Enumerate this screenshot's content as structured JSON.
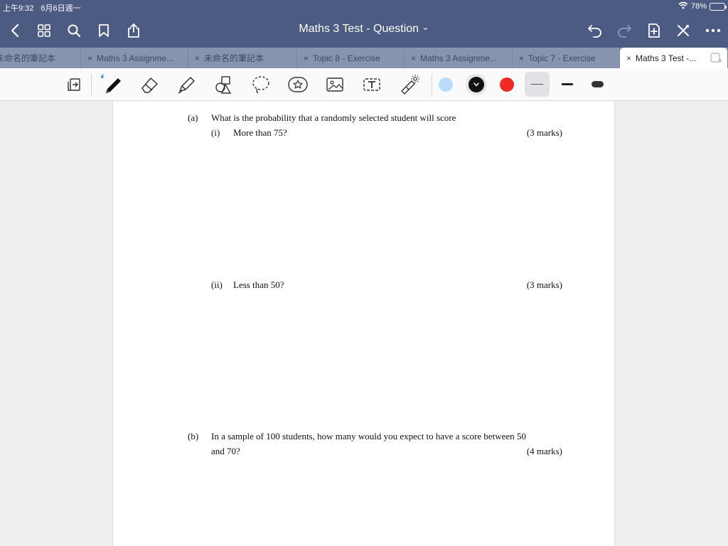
{
  "status": {
    "time": "上午9:32",
    "date": "6月6日週一",
    "battery": "78%",
    "battery_level": 0.78
  },
  "nav": {
    "title": "Maths 3 Test - Question",
    "title_chevron": "⌄"
  },
  "tabs": [
    {
      "label": "未命名的筆記本",
      "closable": false
    },
    {
      "label": "Maths 3 Assignme...",
      "closable": true
    },
    {
      "label": "未命名的筆記本",
      "closable": true
    },
    {
      "label": "Topic 8 - Exercise",
      "closable": true
    },
    {
      "label": "Maths 3 Assignme...",
      "closable": true
    },
    {
      "label": "Topic 7 - Exercise",
      "closable": true
    },
    {
      "label": "Maths 3 Test -...",
      "closable": true,
      "active": true
    }
  ],
  "tab_close_glyph": "×",
  "toolbar": {
    "colors": {
      "light_blue": "#b9dcfb",
      "black": "#111111",
      "red": "#ee2b24"
    }
  },
  "document": {
    "a_label": "(a)",
    "a_text": "What is the probability that a randomly selected student will score",
    "a_i_label": "(i)",
    "a_i_text": "More than 75?",
    "a_i_marks": "(3 marks)",
    "a_ii_label": "(ii)",
    "a_ii_text": "Less than 50?",
    "a_ii_marks": "(3 marks)",
    "b_label": "(b)",
    "b_text_1": "In a sample of 100 students, how many would you expect to have a score between 50",
    "b_text_2": "and 70?",
    "b_marks": "(4 marks)"
  }
}
